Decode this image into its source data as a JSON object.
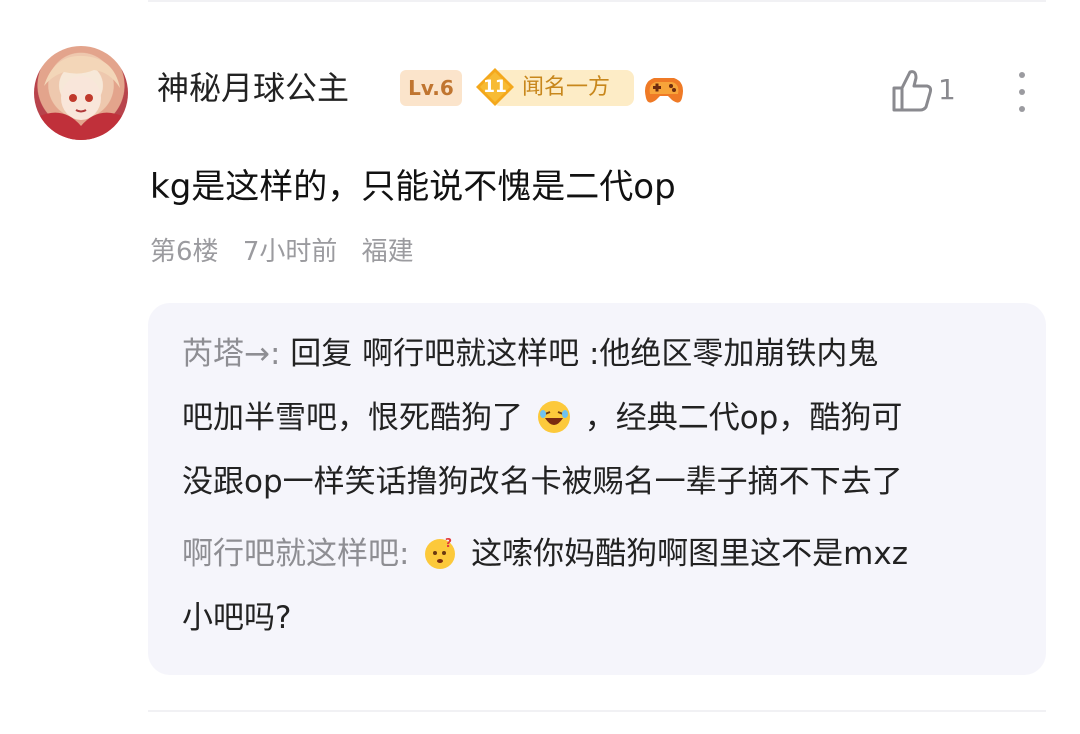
{
  "comment": {
    "username": "神秘月球公主",
    "level_badge": "Lv.6",
    "fan_badge": {
      "level": "11",
      "title": "闻名一方"
    },
    "like_count": "1",
    "text": "kg是这样的，只能说不愧是二代op",
    "floor": "第6楼",
    "time": "7小时前",
    "location": "福建"
  },
  "replies": {
    "reply1": {
      "author": "芮塔→:",
      "line1": "回复 啊行吧就这样吧 :他绝区零加崩铁内鬼",
      "line2_a": "吧加半雪吧，恨死酷狗了",
      "line2_b": "，经典二代op，酷狗可",
      "line3": "没跟op一样笑话撸狗改名卡被赐名一辈子摘不下去了"
    },
    "reply2": {
      "author": "啊行吧就这样吧:",
      "line1": "这嗦你妈酷狗啊图里这不是mxz",
      "line2": "小吧吗?"
    }
  },
  "icons": {
    "like": "thumbs-up-icon",
    "more": "more-vertical-icon",
    "game": "gamepad-icon",
    "emoji_laugh": "laughing-emoji",
    "emoji_thinking": "thinking-emoji"
  },
  "colors": {
    "level_badge_bg": "#fbe4cb",
    "level_badge_text": "#c07530",
    "fan_badge_text": "#c8871c",
    "reply_bg": "#f5f5fb",
    "meta_text": "#9b9b9f"
  }
}
